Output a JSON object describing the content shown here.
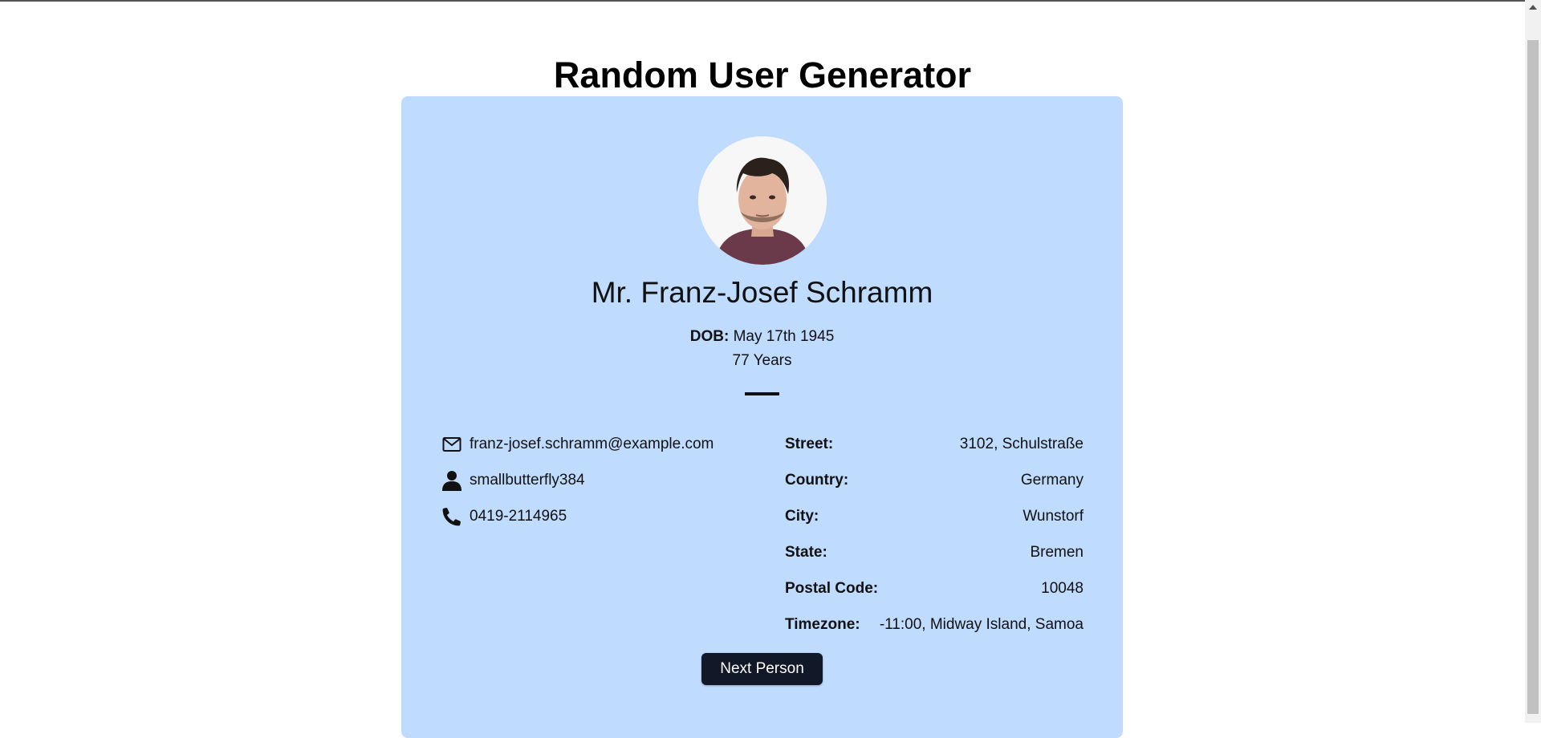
{
  "page": {
    "title": "Random User Generator"
  },
  "user": {
    "name": "Mr. Franz-Josef Schramm",
    "dob_label": "DOB:",
    "dob_value": "May 17th 1945",
    "age": "77 Years",
    "email": "franz-josef.schramm@example.com",
    "username": "smallbutterfly384",
    "phone": "0419-2114965"
  },
  "address": {
    "rows": [
      {
        "label": "Street:",
        "value": "3102, Schulstraße"
      },
      {
        "label": "Country:",
        "value": "Germany"
      },
      {
        "label": "City:",
        "value": "Wunstorf"
      },
      {
        "label": "State:",
        "value": "Bremen"
      },
      {
        "label": "Postal Code:",
        "value": "10048"
      },
      {
        "label": "Timezone:",
        "value": "-11:00, Midway Island, Samoa"
      }
    ]
  },
  "actions": {
    "next_label": "Next Person"
  },
  "icons": {
    "email": "mail-icon",
    "username": "user-icon",
    "phone": "phone-icon"
  },
  "colors": {
    "card_bg": "#bfdbfe",
    "button_bg": "#111827",
    "button_text": "#ffffff"
  }
}
